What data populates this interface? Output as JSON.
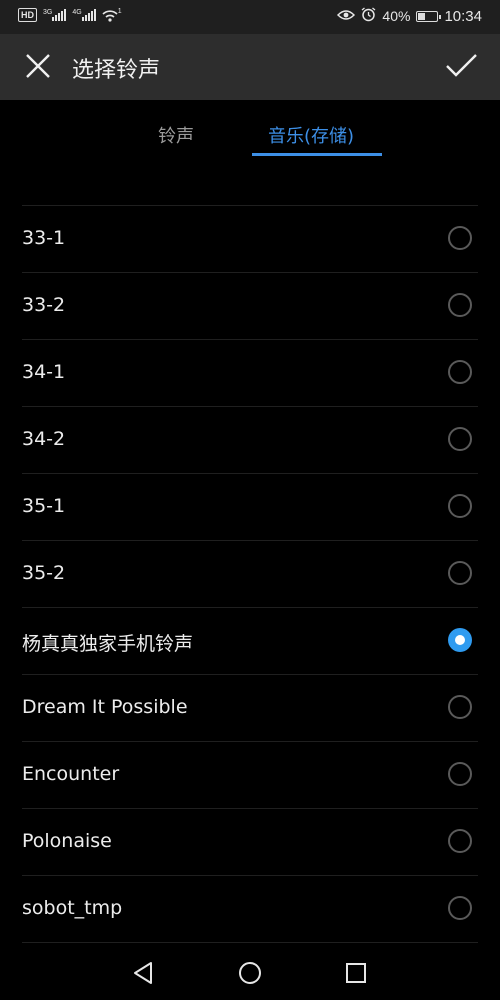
{
  "status_bar": {
    "hd": "HD",
    "net1": "3G",
    "net2": "4G",
    "wifi_badge": "1",
    "battery_text": "40%",
    "battery_level": 0.4,
    "time": "10:34"
  },
  "app_bar": {
    "title": "选择铃声",
    "close_icon": "close-icon",
    "confirm_icon": "check-icon"
  },
  "tabs": [
    {
      "label": "铃声",
      "active": false
    },
    {
      "label": "音乐(存储)",
      "active": true
    }
  ],
  "accent_color": "#3d8fe6",
  "songs": [
    {
      "label": "33-1",
      "selected": false
    },
    {
      "label": "33-2",
      "selected": false
    },
    {
      "label": "34-1",
      "selected": false
    },
    {
      "label": "34-2",
      "selected": false
    },
    {
      "label": "35-1",
      "selected": false
    },
    {
      "label": "35-2",
      "selected": false
    },
    {
      "label": "杨真真独家手机铃声",
      "selected": true
    },
    {
      "label": "Dream It Possible",
      "selected": false
    },
    {
      "label": "Encounter",
      "selected": false
    },
    {
      "label": "Polonaise",
      "selected": false
    },
    {
      "label": "sobot_tmp",
      "selected": false
    }
  ],
  "nav_bar": [
    "back-icon",
    "home-icon",
    "recents-icon"
  ]
}
